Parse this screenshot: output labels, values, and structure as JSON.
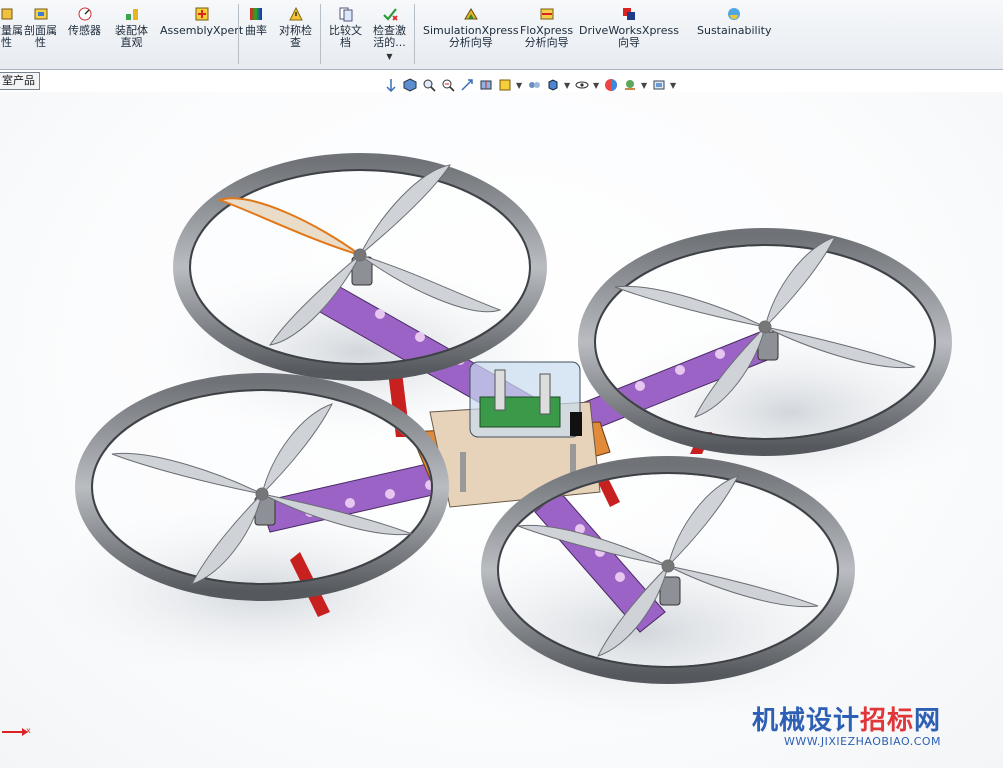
{
  "ribbon": {
    "items": [
      {
        "line1": "质量属",
        "line2": "性",
        "icon": "mass-properties-icon"
      },
      {
        "line1": "剖面属",
        "line2": "性",
        "icon": "section-properties-icon"
      },
      {
        "line1": "传感器",
        "line2": "",
        "icon": "sensor-icon"
      },
      {
        "line1": "装配体",
        "line2": "直观",
        "icon": "assembly-visualization-icon"
      },
      {
        "line1": "AssemblyXpert",
        "line2": "",
        "icon": "assemblyxpert-icon"
      },
      {
        "line1": "曲率",
        "line2": "",
        "icon": "curvature-icon"
      },
      {
        "line1": "对称检",
        "line2": "查",
        "icon": "symmetry-check-icon"
      },
      {
        "line1": "比较文",
        "line2": "档",
        "icon": "compare-documents-icon"
      },
      {
        "line1": "检查激",
        "line2": "活的...",
        "icon": "check-active-icon"
      },
      {
        "line1": "SimulationXpress",
        "line2": "分析向导",
        "icon": "simulationxpress-icon"
      },
      {
        "line1": "FloXpress",
        "line2": "分析向导",
        "icon": "floxpress-icon"
      },
      {
        "line1": "DriveWorksXpress",
        "line2": "向导",
        "icon": "driveworksxpress-icon"
      },
      {
        "line1": "Sustainability",
        "line2": "",
        "icon": "sustainability-icon"
      }
    ]
  },
  "tree_tab": {
    "label": "室产品"
  },
  "watermark": {
    "cn_blue": "机械设计",
    "cn_red": "招标",
    "cn_blue2": "网",
    "en": "WWW.JIXIEZHAOBIAO.COM"
  },
  "triad": {
    "axis": "x"
  },
  "colors": {
    "frame": "#9b63c6",
    "ring": "#8c8f94",
    "prop": "#c9ccd0",
    "leg": "#c8201f",
    "plate": "#e08a3a"
  }
}
